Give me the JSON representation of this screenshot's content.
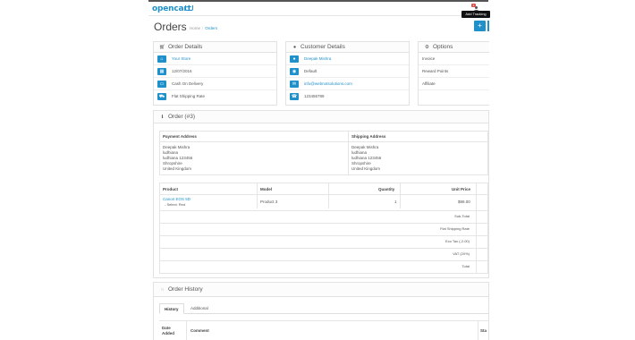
{
  "header": {
    "logo_text": "opencart",
    "notification_count": "1",
    "tooltip": "Add Tracking"
  },
  "page": {
    "title": "Orders",
    "breadcrumb": [
      "Home",
      "Orders"
    ]
  },
  "order_details": {
    "title": "Order Details",
    "rows": [
      {
        "icon": "store-icon",
        "glyph": "⌂",
        "value": "Your Store",
        "link": true
      },
      {
        "icon": "calendar-icon",
        "glyph": "▦",
        "value": "12/07/2016",
        "link": false
      },
      {
        "icon": "credit-card-icon",
        "glyph": "▭",
        "value": "Cash On Delivery",
        "link": false
      },
      {
        "icon": "truck-icon",
        "glyph": "⛟",
        "value": "Flat Shipping Rate",
        "link": false
      }
    ]
  },
  "customer_details": {
    "title": "Customer Details",
    "rows": [
      {
        "icon": "user-icon",
        "glyph": "●",
        "value": "Deepak Mishra",
        "link": true
      },
      {
        "icon": "group-icon",
        "glyph": "◉",
        "value": "Default",
        "link": false
      },
      {
        "icon": "envelope-icon",
        "glyph": "✉",
        "value": "info@webnotsolutions.com",
        "link": true
      },
      {
        "icon": "phone-icon",
        "glyph": "☎",
        "value": "123456789",
        "link": false
      }
    ]
  },
  "options": {
    "title": "Options",
    "rows": [
      "Invoice",
      "Reward Points",
      "Affiliate"
    ]
  },
  "order": {
    "title": "Order (#3)",
    "address_headers": [
      "Payment Address",
      "Shipping Address"
    ],
    "payment_address": [
      "Deepak Mishra",
      "ludhiana",
      "ludhiana 123456",
      "Shropshire",
      "United Kingdom"
    ],
    "shipping_address": [
      "Deepak Mishra",
      "ludhiana",
      "ludhiana 123456",
      "Shropshire",
      "United Kingdom"
    ],
    "product_headers": [
      "Product",
      "Model",
      "Quantity",
      "Unit Price"
    ],
    "product": {
      "name": "Canon EOS 5D",
      "option": "- Select: Red",
      "model": "Product 3",
      "quantity": "1",
      "unit_price": "$98.00"
    },
    "totals": [
      "Sub-Total",
      "Flat Shipping Rate",
      "Eco Tax (-2.00)",
      "VAT (20%)",
      "Total"
    ]
  },
  "history": {
    "title": "Order History",
    "tabs": [
      "History",
      "Additional"
    ],
    "columns": [
      "Date Added",
      "Comment",
      "Sta"
    ]
  }
}
